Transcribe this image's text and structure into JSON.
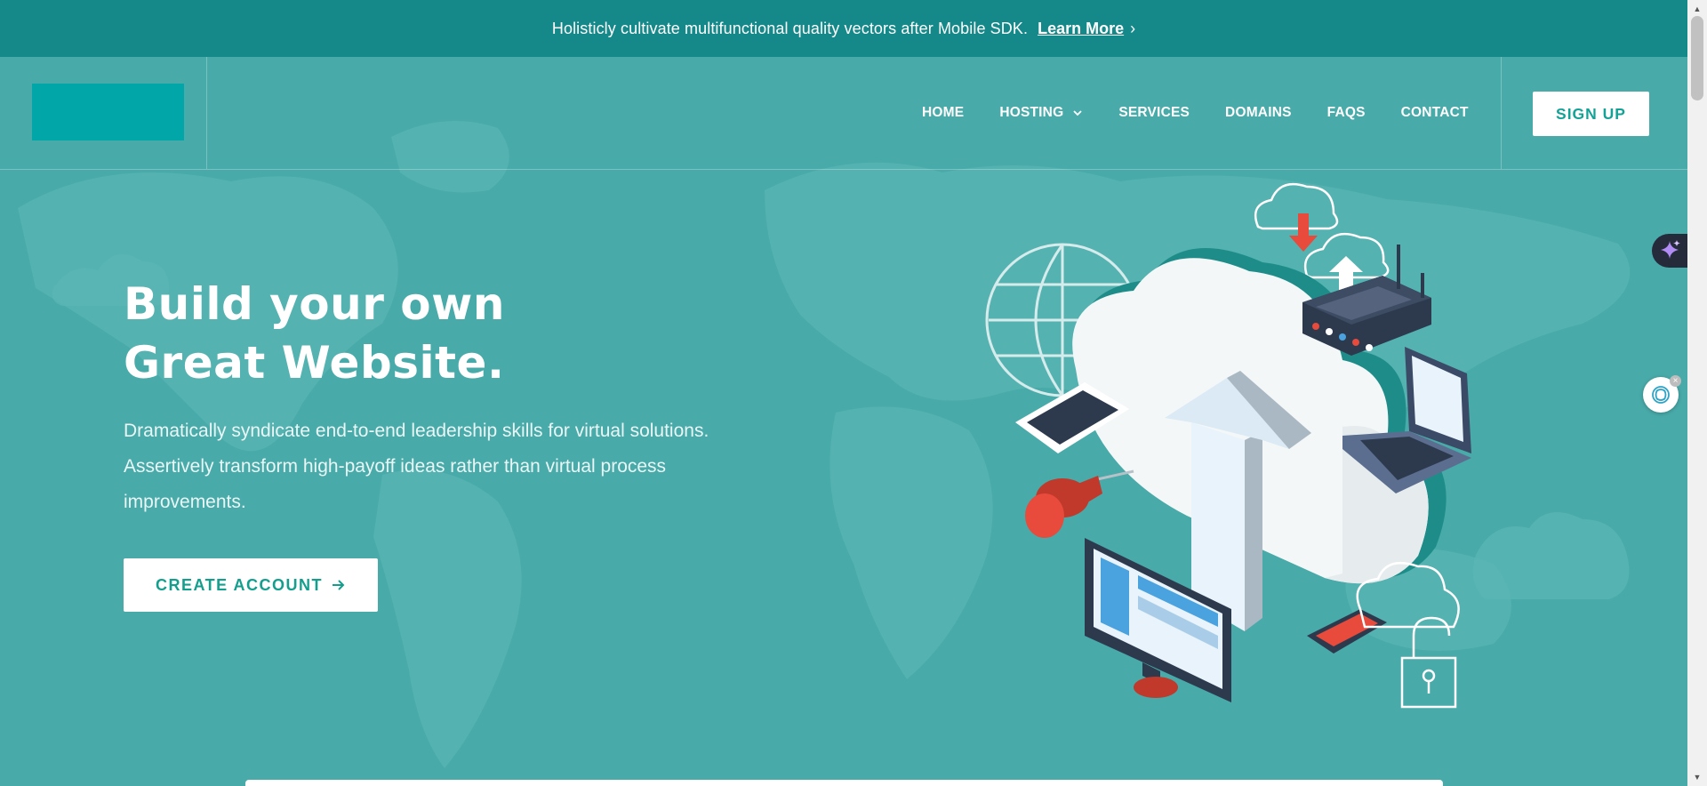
{
  "topbar": {
    "message": "Holisticly cultivate multifunctional quality vectors after Mobile SDK.",
    "link_label": "Learn More",
    "link_chevron": "›"
  },
  "header": {
    "nav": [
      {
        "label": "HOME"
      },
      {
        "label": "HOSTING",
        "has_dropdown": true
      },
      {
        "label": "SERVICES"
      },
      {
        "label": "DOMAINS"
      },
      {
        "label": "FAQS"
      },
      {
        "label": "CONTACT"
      }
    ],
    "signup_label": "SIGN UP"
  },
  "hero": {
    "title_line1": "Build your own",
    "title_line2": "Great Website.",
    "description": "Dramatically syndicate end-to-end leadership skills for virtual solutions. Assertively transform high-payoff ideas rather than virtual process improvements.",
    "cta_label": "CREATE ACCOUNT",
    "cta_icon": "arrow-right-icon"
  },
  "colors": {
    "topbar_bg": "#15898a",
    "hero_bg": "#48aaa9",
    "logo_bg": "#00a6a8",
    "button_text": "#14a296"
  },
  "icons": {
    "hosting_caret": "chevron-down-icon",
    "extension_1": "sparkle-icon",
    "extension_2": "ai-assistant-icon",
    "illustration": "cloud-hosting-illustration"
  }
}
